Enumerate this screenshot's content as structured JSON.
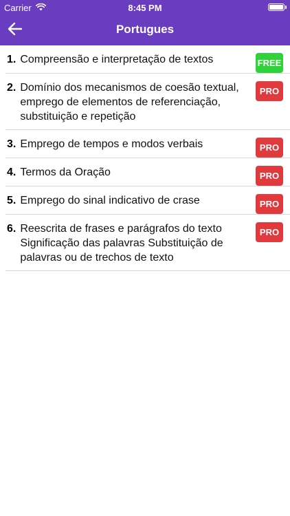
{
  "status_bar": {
    "carrier": "Carrier",
    "time": "8:45 PM",
    "wifi_icon": "wifi-icon",
    "battery_icon": "battery-icon"
  },
  "nav": {
    "title": "Portugues",
    "back_icon": "arrow-left-icon"
  },
  "colors": {
    "header": "#6a3cc0",
    "free_badge": "#2fd23a",
    "pro_badge": "#e03a3e"
  },
  "topics": [
    {
      "number": "1.",
      "title": "Compreensão e interpretação de textos",
      "badge": "FREE"
    },
    {
      "number": "2.",
      "title": "Domínio dos mecanismos de coesão textual, emprego de elementos de referenciação, substituição e repetição",
      "badge": "PRO"
    },
    {
      "number": "3.",
      "title": "Emprego de tempos e modos verbais",
      "badge": "PRO"
    },
    {
      "number": "4.",
      "title": "Termos da Oração",
      "badge": "PRO"
    },
    {
      "number": "5.",
      "title": "Emprego do sinal indicativo de crase",
      "badge": "PRO"
    },
    {
      "number": "6.",
      "title": "Reescrita de frases e parágrafos do texto Significação das palavras Substituição de palavras ou de trechos de texto",
      "badge": "PRO"
    }
  ]
}
